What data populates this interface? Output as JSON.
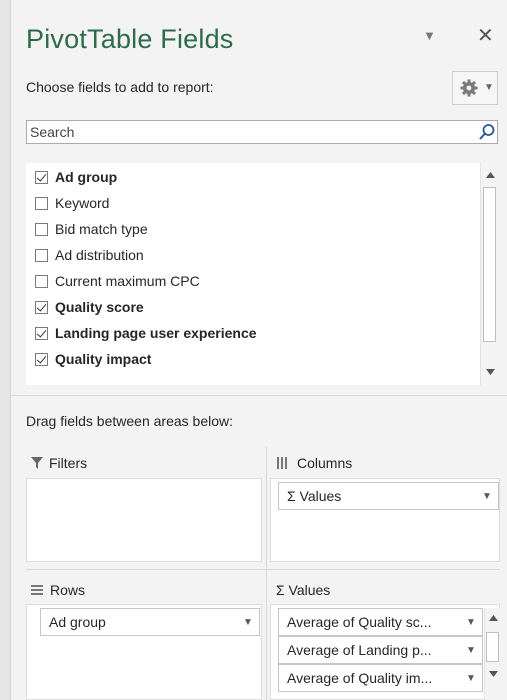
{
  "pane": {
    "title": "PivotTable Fields",
    "choose_label": "Choose fields to add to report:",
    "search_placeholder": "Search",
    "drag_label": "Drag fields between areas below:"
  },
  "fields": [
    {
      "label": "Ad group",
      "checked": true
    },
    {
      "label": "Keyword",
      "checked": false
    },
    {
      "label": "Bid match type",
      "checked": false
    },
    {
      "label": "Ad distribution",
      "checked": false
    },
    {
      "label": "Current maximum CPC",
      "checked": false
    },
    {
      "label": "Quality score",
      "checked": true
    },
    {
      "label": "Landing page user experience",
      "checked": true
    },
    {
      "label": "Quality impact",
      "checked": true
    }
  ],
  "areas": {
    "filters": {
      "label": "Filters",
      "icon": "filter-icon",
      "items": []
    },
    "columns": {
      "label": "Columns",
      "icon": "columns-icon",
      "items": [
        "Σ Values"
      ]
    },
    "rows": {
      "label": "Rows",
      "icon": "rows-icon",
      "items": [
        "Ad group"
      ]
    },
    "values": {
      "label": "Σ Values",
      "icon": "sigma-icon",
      "items": [
        "Average of Quality sc...",
        "Average of Landing p...",
        "Average of Quality im..."
      ]
    }
  },
  "colors": {
    "title": "#2e6b4b",
    "search_icon": "#2b579a"
  }
}
